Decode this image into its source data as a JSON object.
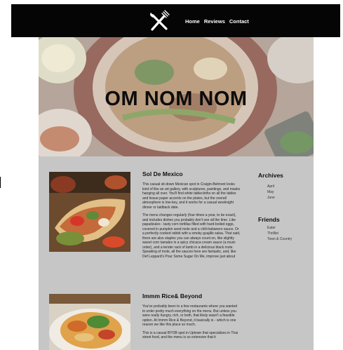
{
  "nav": {
    "logo_icon": "fork-knife-icon",
    "links": [
      "Home",
      "Reviews",
      "Contact"
    ]
  },
  "hero": {
    "title": "OM NOM NOM",
    "image": "food-bowl-photo"
  },
  "posts": [
    {
      "title": "Sol De Mexico",
      "image": "burrito-photo",
      "paragraphs": [
        "This casual sit-down Mexican spot in Craigin-Belmont looks kind of like an art gallery, with sculptures, paintings, and masks hanging all over. You'll find white tablecloths on all the tables and tissue paper accents on the plates, but the overall atmosphere is low-key, and it works for a casual weeknight dinner or laidback date.",
        "The menu changes regularly (four times a year, to be exact), and includes dishes you probably don't see all the time. Like papadzules - tasty corn tortillas filled with hard-boiled eggs, covered in pumpkin seed mole and a chili-habanero sauce. Or a perfectly cooked rabbit with a smoky guajillo salsa. That said, there are also staples you can always count on, like slightly sweet corn tamales in a spicy chicaca cream sauce (a must-order), and a tender rack of lamb in a delicious black mole. Speaking of mole, all the sauces here are fantastic, and, like Def Leppard's Pour Some Sugar On Me, improve just about"
      ]
    },
    {
      "title": "Immm Rice& Beyond",
      "image": "noodle-dish-photo",
      "paragraphs": [
        "You've probably been to a few restaurants where you wanted to order pretty much everything on the menu. But unless you were really hungry, rich, or both, that likely wasn't a feasible option. At Immm Rice & Beyond, it basically is - which is one reason we like this place so much.",
        "This is a casual BYOB spot in Uptown that specializes in Thai street food, and the menu is so extensive that it"
      ]
    }
  ],
  "sidebar": {
    "archives_heading": "Archives",
    "archives": [
      "April",
      "May",
      "June"
    ],
    "friends_heading": "Friends",
    "friends": [
      "Eater",
      "Thrillist",
      "Town & Country"
    ]
  },
  "colors": {
    "navbar": "#050505",
    "content_bg": "#c6c6c6"
  }
}
